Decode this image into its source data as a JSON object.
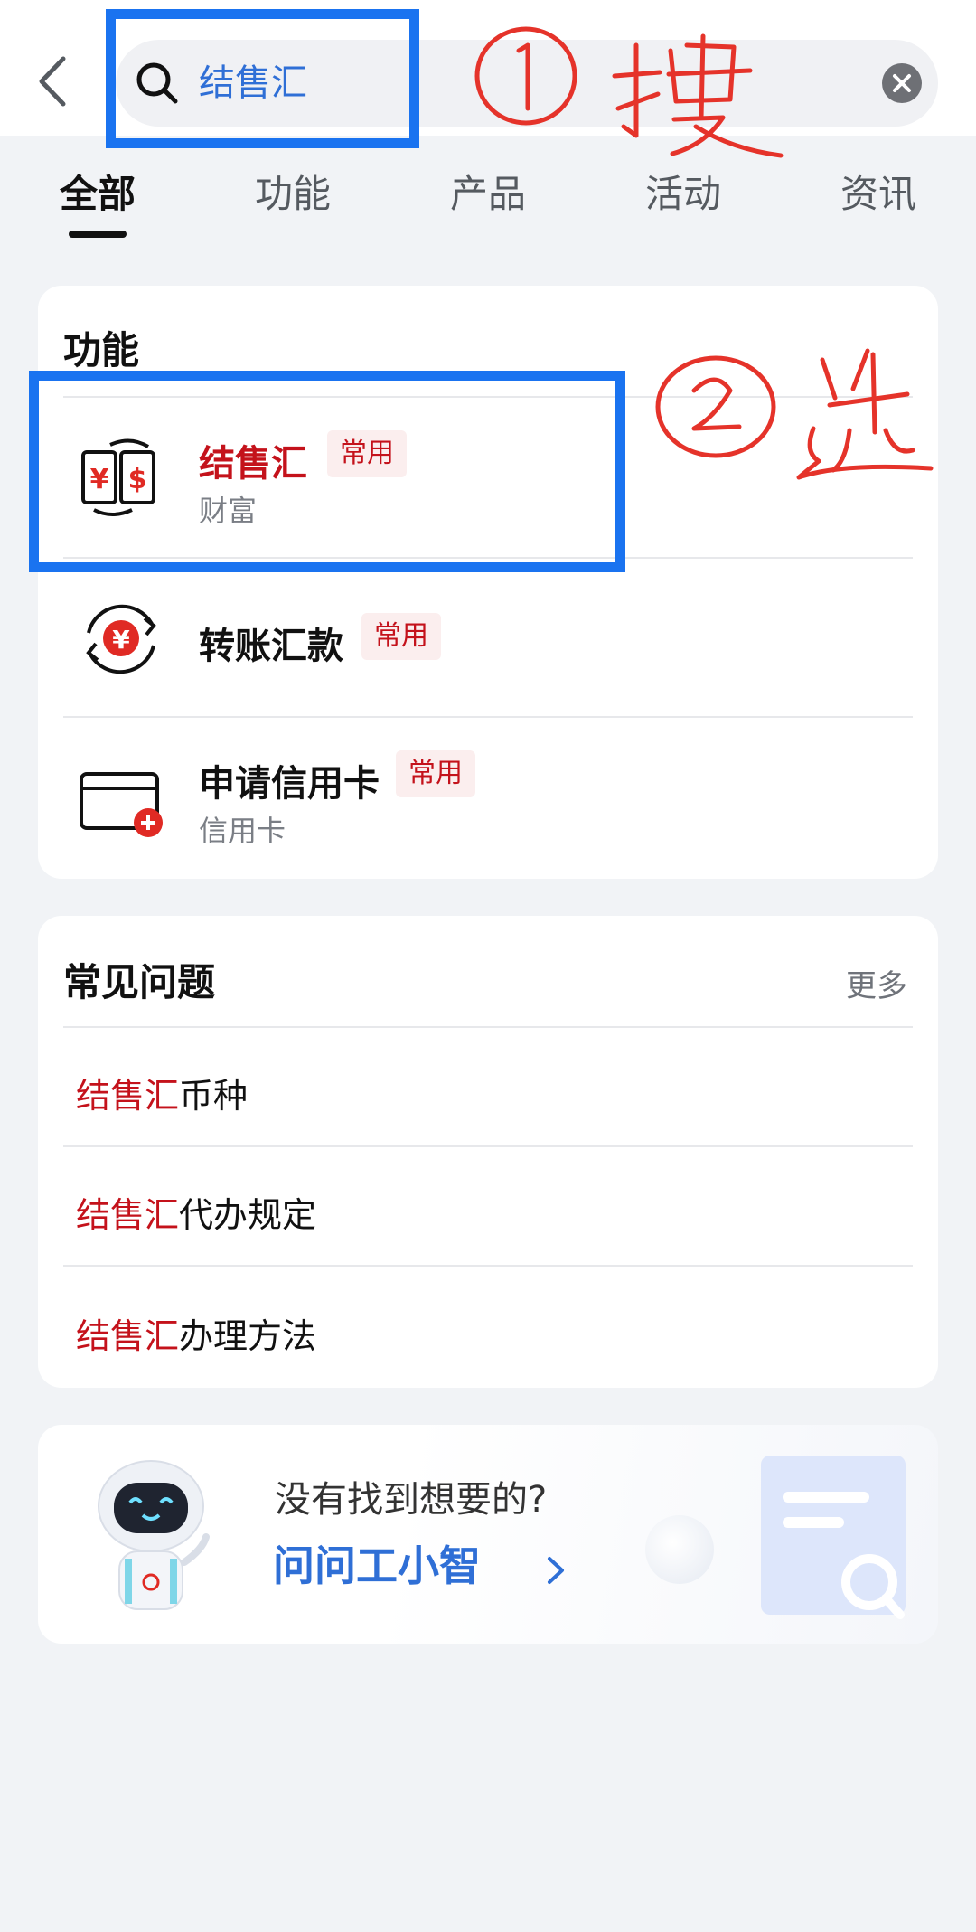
{
  "search": {
    "query": "结售汇"
  },
  "tabs": [
    {
      "label": "全部",
      "active": true
    },
    {
      "label": "功能",
      "active": false
    },
    {
      "label": "产品",
      "active": false
    },
    {
      "label": "活动",
      "active": false
    },
    {
      "label": "资讯",
      "active": false
    }
  ],
  "functions": {
    "title": "功能",
    "items": [
      {
        "name": "结售汇",
        "badge": "常用",
        "sub": "财富",
        "icon": "currency-exchange-icon"
      },
      {
        "name": "转账汇款",
        "badge": "常用",
        "sub": "",
        "icon": "transfer-icon"
      },
      {
        "name": "申请信用卡",
        "badge": "常用",
        "sub": "信用卡",
        "icon": "credit-card-add-icon"
      }
    ]
  },
  "faq": {
    "title": "常见问题",
    "more_label": "更多",
    "items": [
      {
        "highlight": "结售汇",
        "rest": "币种"
      },
      {
        "highlight": "结售汇",
        "rest": "代办规定"
      },
      {
        "highlight": "结售汇",
        "rest": "办理方法"
      }
    ]
  },
  "assistant": {
    "question": "没有找到想要的?",
    "link_label": "问问工小智"
  },
  "colors": {
    "accent_blue": "#2f6fd6",
    "highlight_red": "#c4121b",
    "annotation_blue": "#1a73f0",
    "annotation_red": "#e5332a"
  }
}
